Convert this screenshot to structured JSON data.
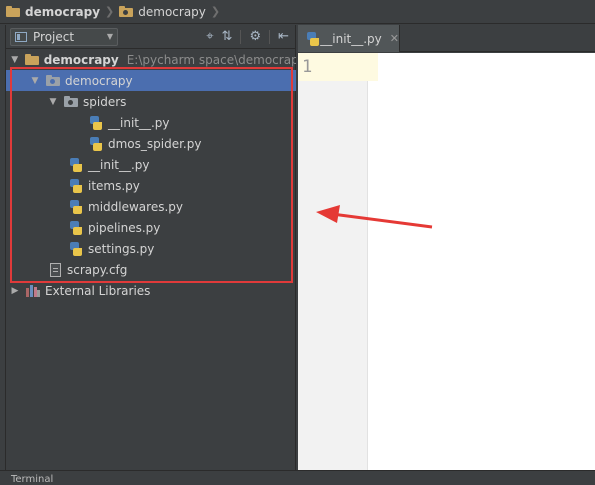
{
  "breadcrumb": [
    {
      "label": "democrapy",
      "bold": true
    },
    {
      "label": "democrapy",
      "bold": false
    }
  ],
  "project_panel": {
    "view_label": "Project",
    "icons": [
      "target-icon",
      "collapse-all-icon",
      "gear-icon",
      "hide-panel-icon"
    ]
  },
  "tree": [
    {
      "label": "democrapy",
      "path": "E:\\pycharm space\\democrapy",
      "indent": 0,
      "arrow": "down",
      "icon": "folder",
      "bold": true
    },
    {
      "label": "democrapy",
      "indent": 1,
      "arrow": "down",
      "icon": "package-folder",
      "selected": true
    },
    {
      "label": "spiders",
      "indent": 2,
      "arrow": "down",
      "icon": "package-folder"
    },
    {
      "label": "__init__.py",
      "indent": 3,
      "icon": "python-file"
    },
    {
      "label": "dmos_spider.py",
      "indent": 3,
      "icon": "python-file"
    },
    {
      "label": "__init__.py",
      "indent": 2,
      "icon": "python-file"
    },
    {
      "label": "items.py",
      "indent": 2,
      "icon": "python-file"
    },
    {
      "label": "middlewares.py",
      "indent": 2,
      "icon": "python-file"
    },
    {
      "label": "pipelines.py",
      "indent": 2,
      "icon": "python-file"
    },
    {
      "label": "settings.py",
      "indent": 2,
      "icon": "python-file"
    },
    {
      "label": "scrapy.cfg",
      "indent": 1,
      "icon": "config-file"
    },
    {
      "label": "External Libraries",
      "indent": 0,
      "arrow": "right",
      "icon": "library"
    }
  ],
  "editor": {
    "tab_label": "__init__.py",
    "line_numbers": [
      "1"
    ]
  },
  "bottom_bar": {
    "label": "Terminal"
  },
  "colors": {
    "selection": "#4b6eaf",
    "highlight_box": "#e03a3a",
    "annotation_arrow": "#e53935"
  }
}
